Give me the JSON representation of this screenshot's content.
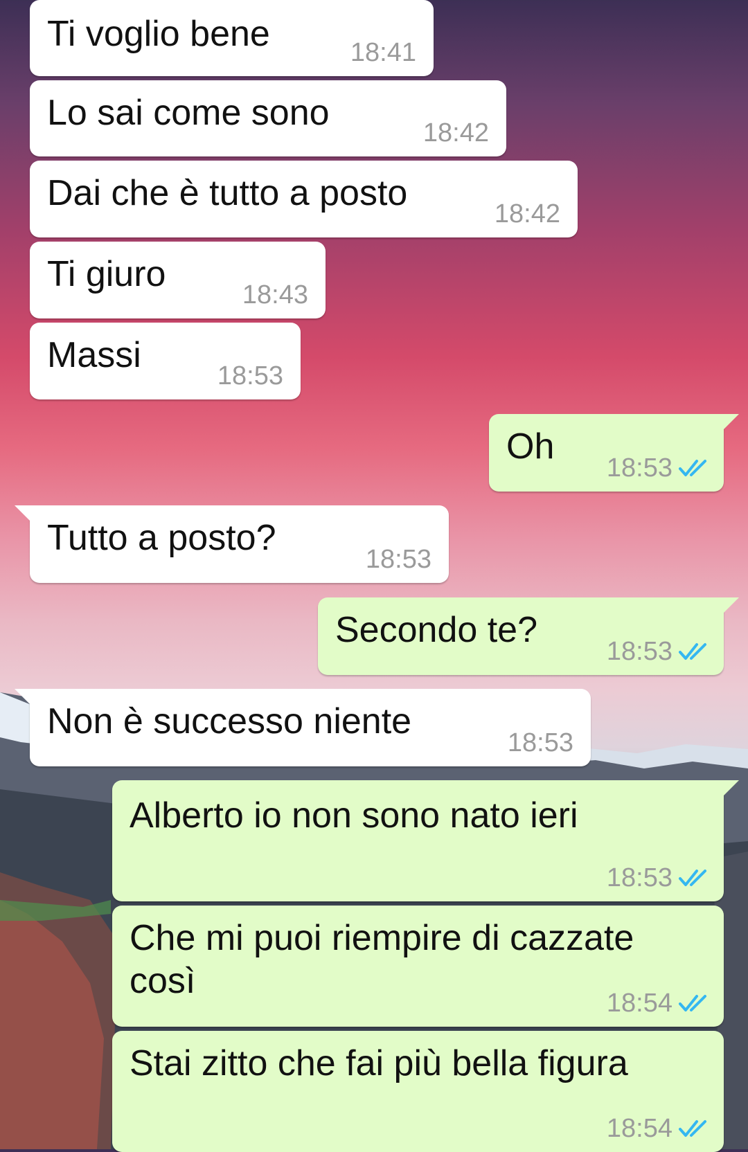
{
  "colors": {
    "incoming_bubble": "#ffffff",
    "outgoing_bubble": "#e2fcc8",
    "timestamp": "#9a9a9a",
    "read_receipt": "#34b7f1"
  },
  "icons": {
    "read_receipt": "double-check-icon"
  },
  "messages": [
    {
      "direction": "incoming",
      "text": "Ti voglio bene",
      "time": "18:41"
    },
    {
      "direction": "incoming",
      "text": "Lo sai come sono",
      "time": "18:42"
    },
    {
      "direction": "incoming",
      "text": "Dai che è tutto a posto",
      "time": "18:42"
    },
    {
      "direction": "incoming",
      "text": "Ti giuro",
      "time": "18:43"
    },
    {
      "direction": "incoming",
      "text": "Massi",
      "time": "18:53"
    },
    {
      "direction": "outgoing",
      "text": "Oh",
      "time": "18:53",
      "status": "read"
    },
    {
      "direction": "incoming",
      "text": "Tutto a posto?",
      "time": "18:53"
    },
    {
      "direction": "outgoing",
      "text": "Secondo te?",
      "time": "18:53",
      "status": "read"
    },
    {
      "direction": "incoming",
      "text": "Non è successo niente",
      "time": "18:53"
    },
    {
      "direction": "outgoing",
      "text": "Alberto io non sono nato ieri",
      "time": "18:53",
      "status": "read"
    },
    {
      "direction": "outgoing",
      "text": "Che mi puoi riempire di cazzate\ncosì",
      "time": "18:54",
      "status": "read"
    },
    {
      "direction": "outgoing",
      "text": "Stai zitto che fai più bella figura",
      "time": "18:54",
      "status": "read"
    }
  ]
}
